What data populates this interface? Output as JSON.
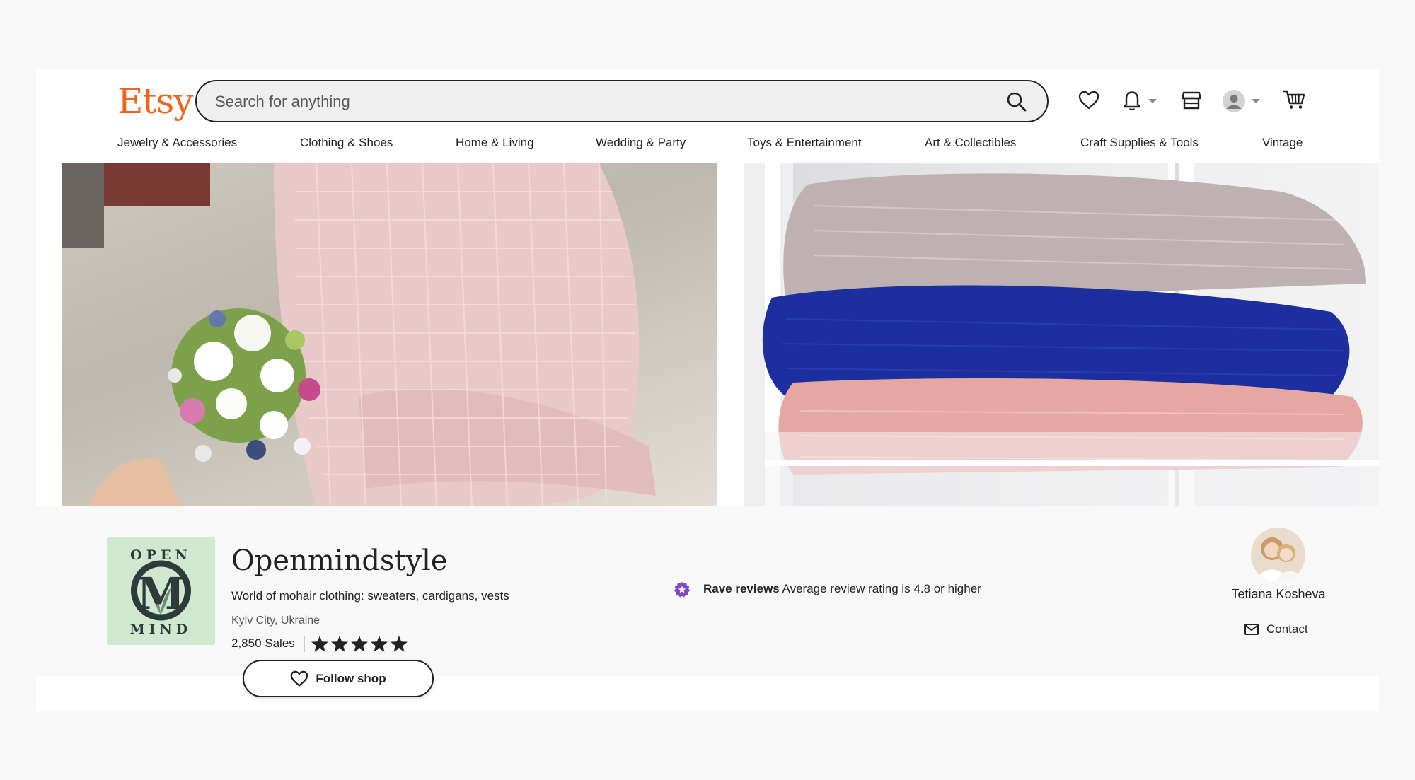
{
  "header": {
    "logo": "Etsy",
    "search_placeholder": "Search for anything",
    "icons": [
      "search-icon",
      "heart-icon",
      "bell-icon",
      "shop-icon",
      "account-icon",
      "cart-icon"
    ]
  },
  "categories": [
    "Jewelry & Accessories",
    "Clothing & Shoes",
    "Home & Living",
    "Wedding & Party",
    "Toys & Entertainment",
    "Art & Collectibles",
    "Craft Supplies & Tools",
    "Vintage"
  ],
  "shop": {
    "name": "Openmindstyle",
    "tagline": "World of mohair clothing: sweaters, cardigans, vests",
    "location": "Kyiv City, Ukraine",
    "sales": "2,850 Sales",
    "rating_stars": 5,
    "follow_label": "Follow shop",
    "logo_text_top": "OPEN",
    "logo_text_bottom": "MIND",
    "logo_letter": "M"
  },
  "badge": {
    "title": "Rave reviews",
    "text": "Average review rating is 4.8 or higher"
  },
  "owner": {
    "name": "Tetiana Kosheva",
    "contact_label": "Contact"
  },
  "colors": {
    "brand": "#F1641E",
    "badge": "#7F49C9"
  }
}
